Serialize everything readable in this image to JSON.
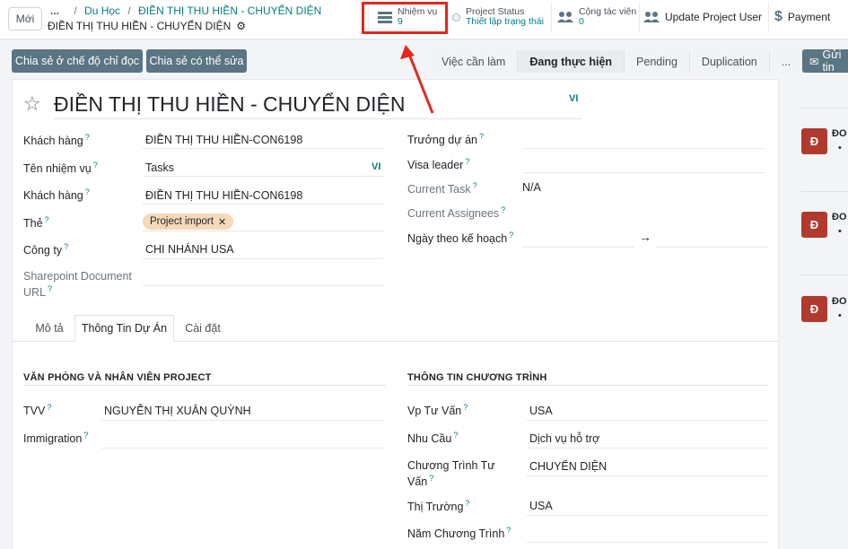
{
  "topbar": {
    "new_label": "Mới",
    "breadcrumb_dots": "...",
    "breadcrumb_parent": "Du Học",
    "breadcrumb_current": "ĐIỀN THỊ THU HIỀN - CHUYỂN DIỆN",
    "record_title": "ĐIỀN THỊ THU HIỀN - CHUYỂN DIỆN",
    "stat_buttons": {
      "tasks": {
        "label": "Nhiệm vụ",
        "value": "9"
      },
      "project_status": {
        "label": "Project Status",
        "value": "Thiết lập trạng thái"
      },
      "collaborators": {
        "label": "Cộng tác viên",
        "value": "0"
      },
      "update_user": {
        "label": "Update Project User"
      },
      "payment": {
        "label": "Payment"
      }
    },
    "highlight_color": "#e0281f"
  },
  "actions": {
    "share_readonly": "Chia sẻ ở chế độ chỉ đọc",
    "share_edit": "Chia sẻ có thể sửa",
    "send": "Gửi tin"
  },
  "pipeline": {
    "stages": [
      "Việc cần làm",
      "Đang thực hiện",
      "Pending",
      "Duplication",
      "..."
    ],
    "active_stage": "Đang thực hiện"
  },
  "form": {
    "title": "ĐIỀN THỊ THU HIỀN - CHUYỂN DIỆN",
    "title_lang": "VI",
    "left_fields": {
      "customer_label": "Khách hàng",
      "customer_value": "ĐIỀN THỊ THU HIỀN-CON6198",
      "task_name_label": "Tên nhiệm vụ",
      "task_name_value": "Tasks",
      "task_name_lang": "VI",
      "customer2_label": "Khách hàng",
      "customer2_value": "ĐIỀN THỊ THU HIỀN-CON6198",
      "tags_label": "Thẻ",
      "tag_value": "Project import",
      "company_label": "Công ty",
      "company_value": "CHI NHÁNH USA",
      "sharepoint_label_1": "Sharepoint Document",
      "sharepoint_label_2": "URL"
    },
    "right_fields": {
      "project_lead_label": "Trưởng dự án",
      "visa_leader_label": "Visa leader",
      "current_task_label": "Current Task",
      "current_task_value": "N/A",
      "current_assignees_label": "Current Assignees",
      "planned_date_label": "Ngày theo kế hoạch",
      "planned_date_arrow": "→"
    },
    "tabs": [
      "Mô tả",
      "Thông Tin Dự Án",
      "Cài đặt"
    ],
    "active_tab": "Thông Tin Dự Án",
    "section_office": {
      "heading": "VĂN PHÒNG VÀ NHÂN VIÊN PROJECT",
      "tvv_label": "TVV",
      "tvv_value": "NGUYỄN THỊ XUÂN QUỲNH",
      "immigration_label": "Immigration"
    },
    "section_program": {
      "heading": "THÔNG TIN CHƯƠNG TRÌNH",
      "office_label": "Vp Tư Vấn",
      "office_value": "USA",
      "need_label": "Nhu Cầu",
      "need_value": "Dịch vụ hỗ trợ",
      "program_label_1": "Chương Trình Tư",
      "program_label_2": "Vấn",
      "program_value": "CHUYỂN DIỆN",
      "market_label": "Thị Trường",
      "market_value": "USA",
      "year_label": "Năm Chương Trình"
    }
  },
  "chatter": {
    "avatar_letter": "Đ",
    "name_prefix": "ĐO",
    "bullet": "•"
  }
}
